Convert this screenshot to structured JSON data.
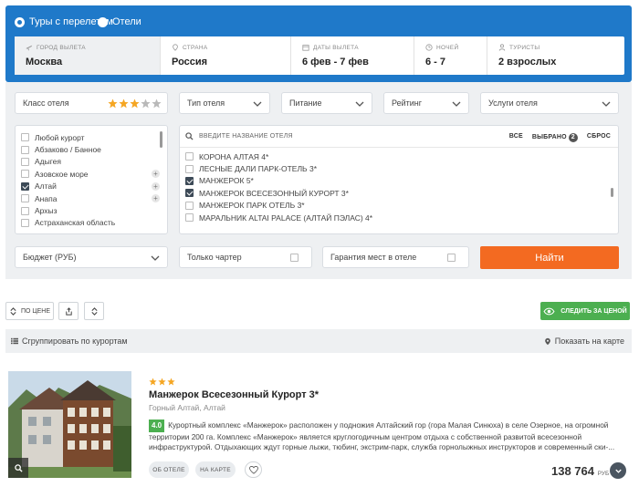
{
  "search": {
    "radio_tours": "Туры с перелетом",
    "radio_hotels": "Отели",
    "fields": [
      {
        "label": "ГОРОД ВЫЛЕТА",
        "value": "Москва"
      },
      {
        "label": "СТРАНА",
        "value": "Россия"
      },
      {
        "label": "ДАТЫ ВЫЛЕТА",
        "value": "6 фев - 7 фев"
      },
      {
        "label": "НОЧЕЙ",
        "value": "6 - 7"
      },
      {
        "label": "ТУРИСТЫ",
        "value": "2 взрослых"
      }
    ]
  },
  "filters": {
    "hotel_class": "Класс отеля",
    "hotel_class_stars": 3,
    "hotel_type": "Тип отеля",
    "meals": "Питание",
    "rating": "Рейтинг",
    "services": "Услуги отеля",
    "resorts": [
      {
        "label": "Любой курорт",
        "checked": false,
        "plus": false
      },
      {
        "label": "Абзаково / Банное",
        "checked": false,
        "plus": false
      },
      {
        "label": "Адыгея",
        "checked": false,
        "plus": false
      },
      {
        "label": "Азовское море",
        "checked": false,
        "plus": true
      },
      {
        "label": "Алтай",
        "checked": true,
        "plus": true
      },
      {
        "label": "Анапа",
        "checked": false,
        "plus": true
      },
      {
        "label": "Архыз",
        "checked": false,
        "plus": false
      },
      {
        "label": "Астраханская область",
        "checked": false,
        "plus": false
      }
    ],
    "hotel_search_placeholder": "ВВЕДИТЕ НАЗВАНИЕ ОТЕЛЯ",
    "tab_all": "ВСЕ",
    "tab_selected": "ВЫБРАНО",
    "selected_count": "2",
    "tab_reset": "СБРОС",
    "hotels": [
      {
        "label": "КОРОНА АЛТАЯ 4*",
        "checked": false
      },
      {
        "label": "ЛЕСНЫЕ ДАЛИ ПАРК-ОТЕЛЬ 3*",
        "checked": false
      },
      {
        "label": "МАНЖЕРОК 5*",
        "checked": true
      },
      {
        "label": "МАНЖЕРОК ВСЕСЕЗОННЫЙ КУРОРТ 3*",
        "checked": true
      },
      {
        "label": "МАНЖЕРОК ПАРК ОТЕЛЬ 3*",
        "checked": false
      },
      {
        "label": "МАРАЛЬНИК ALTAI PALACE (АЛТАЙ ПЭЛАС) 4*",
        "checked": false
      }
    ],
    "budget": "Бюджет (РУБ)",
    "charter_only": "Только чартер",
    "guarantee": "Гарантия мест в отеле",
    "find_button": "Найти"
  },
  "toolbar": {
    "sort_label": "ПО ЦЕНЕ",
    "track_price": "СЛЕДИТЬ ЗА ЦЕНОЙ",
    "group_by": "Сгруппировать по курортам",
    "show_on_map": "Показать на карте"
  },
  "result": {
    "stars": 3,
    "title": "Манжерок Всесезонный Курорт 3*",
    "location": "Горный Алтай, Алтай",
    "rating": "4.0",
    "description": "Курортный комплекс «Манжерок» расположен у подножия Алтайский гор (гора Малая Синюха) в селе Озерное, на огромной территории 200 га. Комплекс «Манжерок» является круглогодичным центром отдыха с собственной развитой всесезонной инфраструктурой. Отдыхающих ждут горные лыжи, тюбинг, экстрим-парк, служба горнолыжных инструкторов и современный ски-...",
    "about_button": "ОБ ОТЕЛЕ",
    "map_button": "НА КАРТЕ",
    "price": "138 764",
    "currency": "РУБ"
  },
  "colors": {
    "brand_blue": "#1f79c9",
    "accent_orange": "#f36a21",
    "green": "#4caf50",
    "star": "#f5a623"
  }
}
